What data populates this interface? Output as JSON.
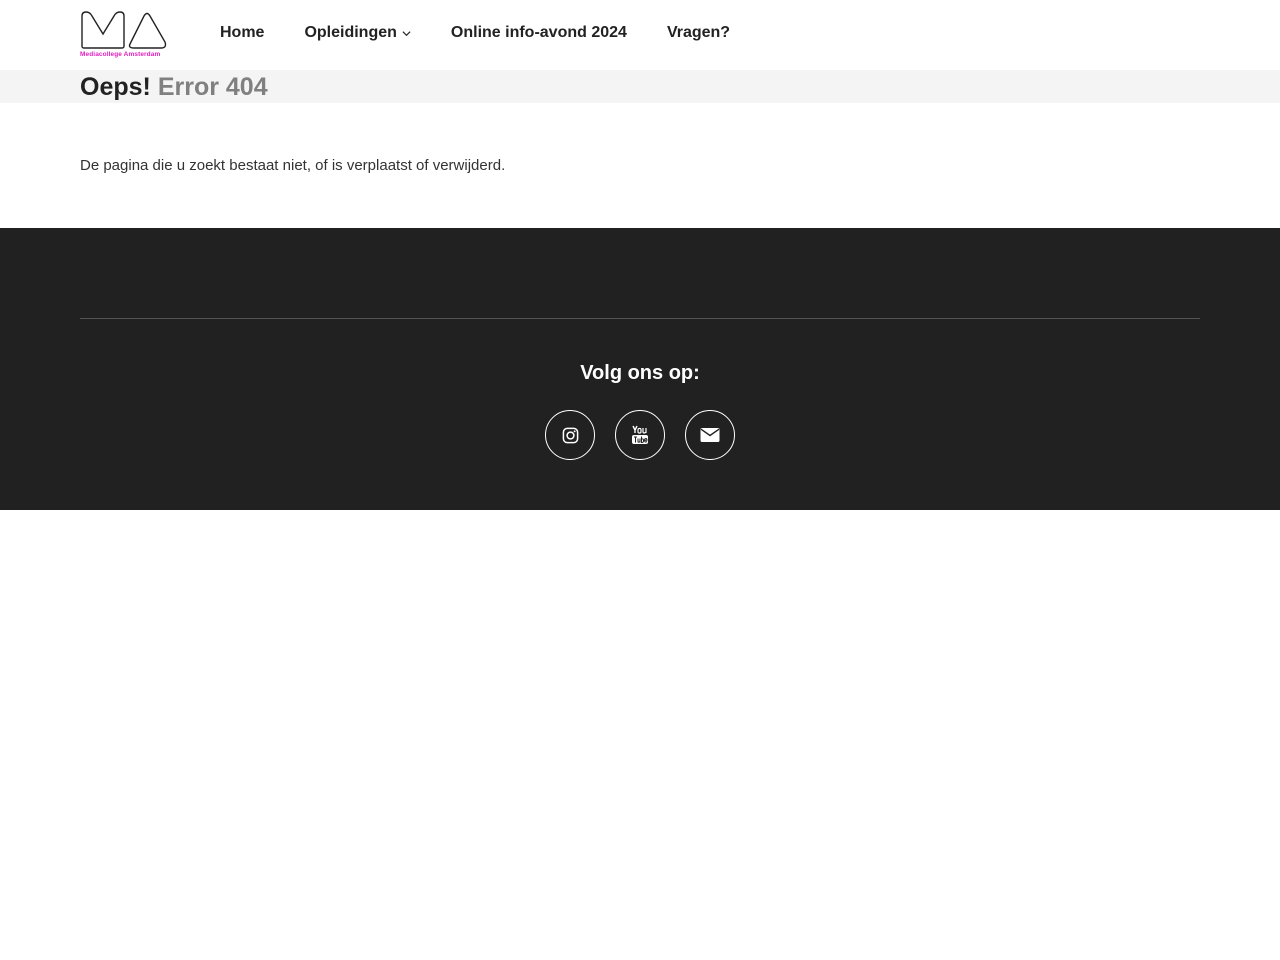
{
  "logo": {
    "subtitle": "Mediacollege Amsterdam",
    "accent_color": "#e020c0"
  },
  "nav": {
    "items": [
      {
        "label": "Home"
      },
      {
        "label": "Opleidingen",
        "has_dropdown": true
      },
      {
        "label": "Online info-avond 2024"
      },
      {
        "label": "Vragen?"
      }
    ]
  },
  "page": {
    "title_strong": "Oeps!",
    "title_muted": "Error 404",
    "message": "De pagina die u zoekt bestaat niet, of is verplaatst of verwijderd."
  },
  "footer": {
    "follow_label": "Volg ons op:",
    "socials": [
      {
        "icon": "instagram-icon"
      },
      {
        "icon": "youtube-icon"
      },
      {
        "icon": "envelope-icon"
      }
    ]
  }
}
